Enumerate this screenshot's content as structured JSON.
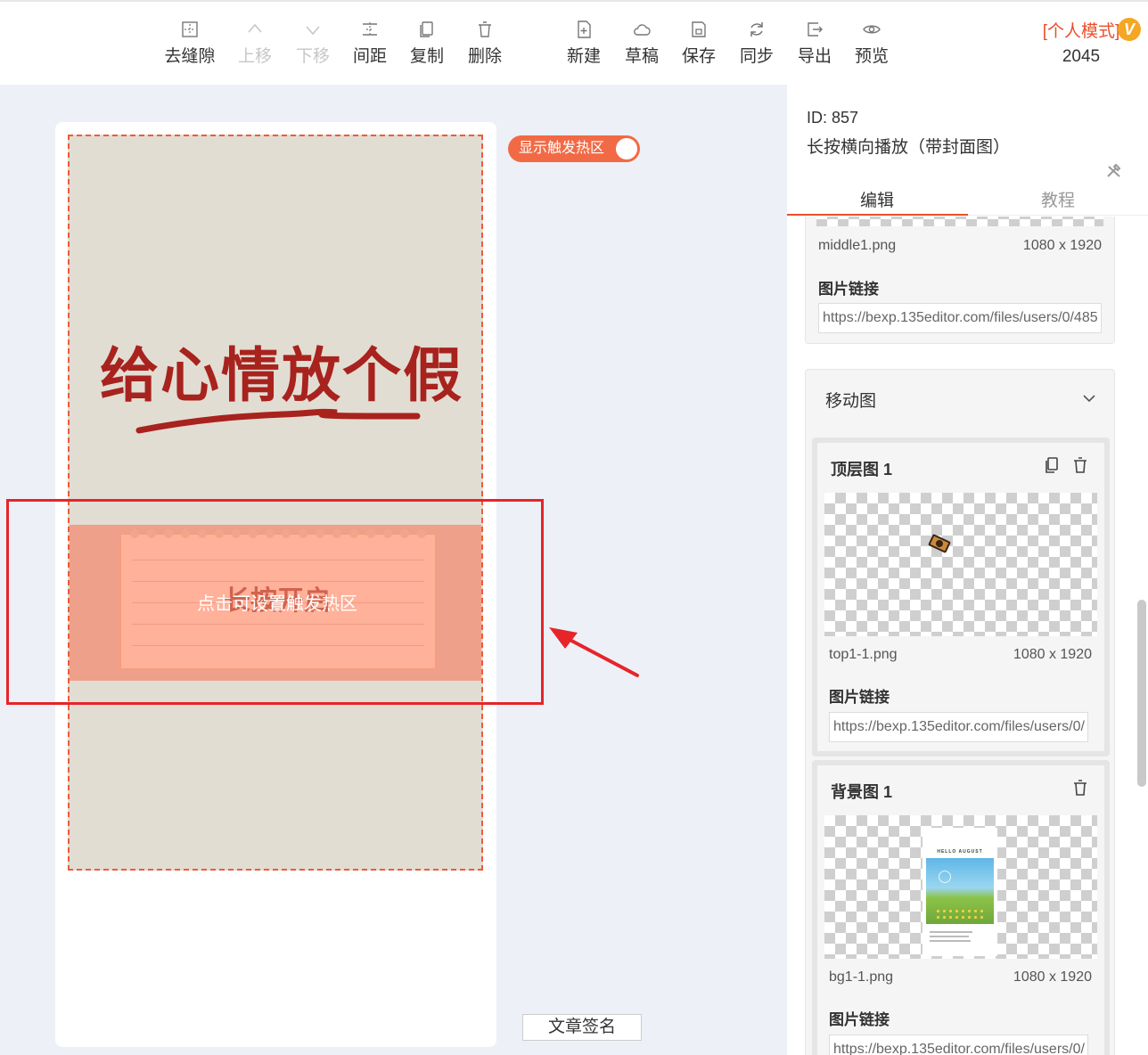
{
  "toolbar": {
    "items": [
      {
        "label": "去缝隙",
        "icon": "grid-icon",
        "disabled": false
      },
      {
        "label": "上移",
        "icon": "chevron-up-icon",
        "disabled": true
      },
      {
        "label": "下移",
        "icon": "chevron-down-icon",
        "disabled": true
      },
      {
        "label": "间距",
        "icon": "spacing-icon",
        "disabled": false
      },
      {
        "label": "复制",
        "icon": "copy-icon",
        "disabled": false
      },
      {
        "label": "删除",
        "icon": "trash-icon",
        "disabled": false
      },
      {
        "label": "新建",
        "icon": "new-file-icon",
        "disabled": false
      },
      {
        "label": "草稿",
        "icon": "cloud-icon",
        "disabled": false
      },
      {
        "label": "保存",
        "icon": "save-icon",
        "disabled": false
      },
      {
        "label": "同步",
        "icon": "sync-icon",
        "disabled": false
      },
      {
        "label": "导出",
        "icon": "export-icon",
        "disabled": false
      },
      {
        "label": "预览",
        "icon": "eye-icon",
        "disabled": false
      }
    ],
    "mode_label": "[个人模式]",
    "mode_badge": "V",
    "mode_number": "2045"
  },
  "canvas": {
    "toggle_label": "显示触发热区",
    "headline": "给心情放个假",
    "note_text": "长按开启",
    "hotzone_text": "点击可设置触发热区",
    "signature_button": "文章签名"
  },
  "panel": {
    "id_text": "ID: 857",
    "template_name": "长按横向播放（带封面图）",
    "tabs": [
      "编辑",
      "教程"
    ],
    "middle_image": {
      "filename": "middle1.png",
      "size": "1080 x 1920",
      "link_label": "图片链接",
      "url": "https://bexp.135editor.com/files/users/0/485"
    },
    "moving_section": {
      "title": "移动图",
      "layers": [
        {
          "title": "顶层图 1",
          "filename": "top1-1.png",
          "size": "1080 x 1920",
          "link_label": "图片链接",
          "url": "https://bexp.135editor.com/files/users/0/"
        },
        {
          "title": "背景图 1",
          "filename": "bg1-1.png",
          "size": "1080 x 1920",
          "link_label": "图片链接",
          "url": "https://bexp.135editor.com/files/users/0/",
          "thumb_heading": "HELLO AUGUST"
        }
      ]
    }
  },
  "colors": {
    "accent": "#ea4f2b",
    "headline": "#a8221e",
    "annotation_red": "#e5252a",
    "canvas_bg": "#e2ddd2"
  }
}
